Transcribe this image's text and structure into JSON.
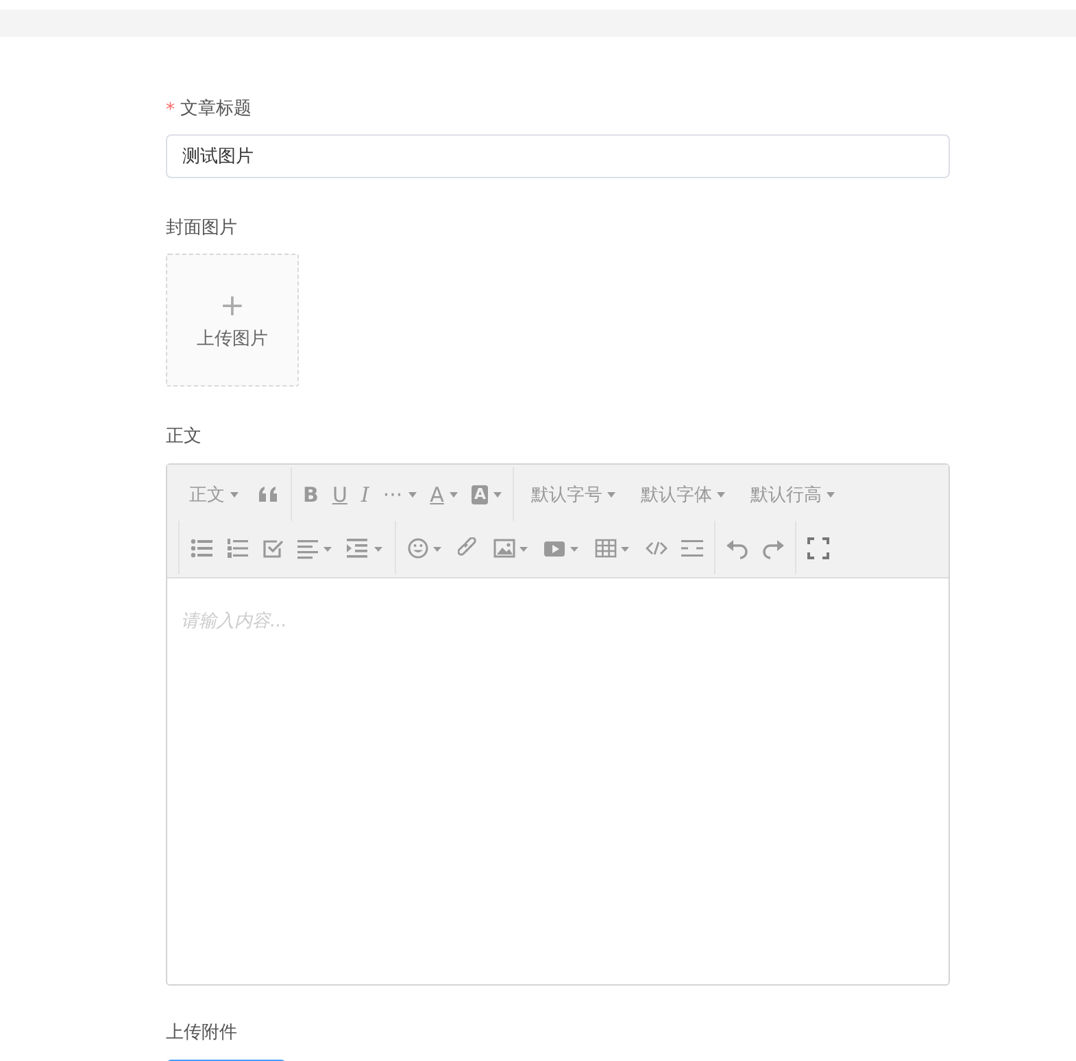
{
  "form": {
    "title_label": "文章标题",
    "required_mark": "*",
    "title_value": "测试图片",
    "cover_label": "封面图片",
    "upload_plus": "+",
    "upload_text": "上传图片",
    "body_label": "正文",
    "body_placeholder": "请输入内容...",
    "attachment_label": "上传附件"
  },
  "toolbar": {
    "paragraph": "正文",
    "bold": "B",
    "underline": "U",
    "italic": "I",
    "more": "···",
    "font_color": "A",
    "background_color": "A",
    "font_size": "默认字号",
    "font_family": "默认字体",
    "line_height": "默认行高"
  }
}
